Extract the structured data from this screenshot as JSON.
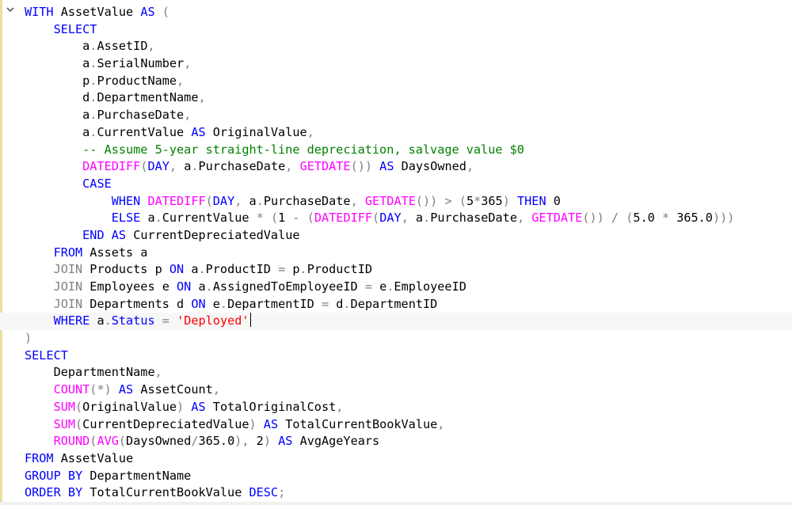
{
  "editor": {
    "fold_icon": "chevron-down-icon",
    "colors": {
      "keyword": "#0000ff",
      "function": "#ff00ff",
      "comment": "#008000",
      "string": "#ff0000",
      "operator": "#808080",
      "plain": "#000000"
    },
    "current_line_index": 18,
    "lines": [
      [
        [
          "kw",
          "WITH"
        ],
        [
          "pl",
          " AssetValue "
        ],
        [
          "kw",
          "AS"
        ],
        [
          "pl",
          " "
        ],
        [
          "op",
          "("
        ]
      ],
      [
        [
          "pl",
          "    "
        ],
        [
          "kw",
          "SELECT"
        ]
      ],
      [
        [
          "pl",
          "        a"
        ],
        [
          "op",
          "."
        ],
        [
          "pl",
          "AssetID"
        ],
        [
          "op",
          ","
        ]
      ],
      [
        [
          "pl",
          "        a"
        ],
        [
          "op",
          "."
        ],
        [
          "pl",
          "SerialNumber"
        ],
        [
          "op",
          ","
        ]
      ],
      [
        [
          "pl",
          "        p"
        ],
        [
          "op",
          "."
        ],
        [
          "pl",
          "ProductName"
        ],
        [
          "op",
          ","
        ]
      ],
      [
        [
          "pl",
          "        d"
        ],
        [
          "op",
          "."
        ],
        [
          "pl",
          "DepartmentName"
        ],
        [
          "op",
          ","
        ]
      ],
      [
        [
          "pl",
          "        a"
        ],
        [
          "op",
          "."
        ],
        [
          "pl",
          "PurchaseDate"
        ],
        [
          "op",
          ","
        ]
      ],
      [
        [
          "pl",
          "        a"
        ],
        [
          "op",
          "."
        ],
        [
          "pl",
          "CurrentValue "
        ],
        [
          "kw",
          "AS"
        ],
        [
          "pl",
          " OriginalValue"
        ],
        [
          "op",
          ","
        ]
      ],
      [
        [
          "pl",
          "        "
        ],
        [
          "cm",
          "-- Assume 5-year straight-line depreciation, salvage value $0"
        ]
      ],
      [
        [
          "pl",
          "        "
        ],
        [
          "fn",
          "DATEDIFF"
        ],
        [
          "op",
          "("
        ],
        [
          "kw",
          "DAY"
        ],
        [
          "op",
          ","
        ],
        [
          "pl",
          " a"
        ],
        [
          "op",
          "."
        ],
        [
          "pl",
          "PurchaseDate"
        ],
        [
          "op",
          ","
        ],
        [
          "pl",
          " "
        ],
        [
          "fn",
          "GETDATE"
        ],
        [
          "op",
          "())"
        ],
        [
          "pl",
          " "
        ],
        [
          "kw",
          "AS"
        ],
        [
          "pl",
          " DaysOwned"
        ],
        [
          "op",
          ","
        ]
      ],
      [
        [
          "pl",
          "        "
        ],
        [
          "kw",
          "CASE"
        ]
      ],
      [
        [
          "pl",
          "            "
        ],
        [
          "kw",
          "WHEN"
        ],
        [
          "pl",
          " "
        ],
        [
          "fn",
          "DATEDIFF"
        ],
        [
          "op",
          "("
        ],
        [
          "kw",
          "DAY"
        ],
        [
          "op",
          ","
        ],
        [
          "pl",
          " a"
        ],
        [
          "op",
          "."
        ],
        [
          "pl",
          "PurchaseDate"
        ],
        [
          "op",
          ","
        ],
        [
          "pl",
          " "
        ],
        [
          "fn",
          "GETDATE"
        ],
        [
          "op",
          "())"
        ],
        [
          "pl",
          " "
        ],
        [
          "op",
          ">"
        ],
        [
          "pl",
          " "
        ],
        [
          "op",
          "("
        ],
        [
          "pl",
          "5"
        ],
        [
          "op",
          "*"
        ],
        [
          "pl",
          "365"
        ],
        [
          "op",
          ")"
        ],
        [
          "pl",
          " "
        ],
        [
          "kw",
          "THEN"
        ],
        [
          "pl",
          " 0"
        ]
      ],
      [
        [
          "pl",
          "            "
        ],
        [
          "kw",
          "ELSE"
        ],
        [
          "pl",
          " a"
        ],
        [
          "op",
          "."
        ],
        [
          "pl",
          "CurrentValue "
        ],
        [
          "op",
          "*"
        ],
        [
          "pl",
          " "
        ],
        [
          "op",
          "("
        ],
        [
          "pl",
          "1 "
        ],
        [
          "op",
          "-"
        ],
        [
          "pl",
          " "
        ],
        [
          "op",
          "("
        ],
        [
          "fn",
          "DATEDIFF"
        ],
        [
          "op",
          "("
        ],
        [
          "kw",
          "DAY"
        ],
        [
          "op",
          ","
        ],
        [
          "pl",
          " a"
        ],
        [
          "op",
          "."
        ],
        [
          "pl",
          "PurchaseDate"
        ],
        [
          "op",
          ","
        ],
        [
          "pl",
          " "
        ],
        [
          "fn",
          "GETDATE"
        ],
        [
          "op",
          "())"
        ],
        [
          "pl",
          " "
        ],
        [
          "op",
          "/"
        ],
        [
          "pl",
          " "
        ],
        [
          "op",
          "("
        ],
        [
          "pl",
          "5.0 "
        ],
        [
          "op",
          "*"
        ],
        [
          "pl",
          " 365.0"
        ],
        [
          "op",
          ")))"
        ]
      ],
      [
        [
          "pl",
          "        "
        ],
        [
          "kw",
          "END"
        ],
        [
          "pl",
          " "
        ],
        [
          "kw",
          "AS"
        ],
        [
          "pl",
          " CurrentDepreciatedValue"
        ]
      ],
      [
        [
          "pl",
          "    "
        ],
        [
          "kw",
          "FROM"
        ],
        [
          "pl",
          " Assets a"
        ]
      ],
      [
        [
          "pl",
          "    "
        ],
        [
          "op",
          "JOIN"
        ],
        [
          "pl",
          " Products p "
        ],
        [
          "kw",
          "ON"
        ],
        [
          "pl",
          " a"
        ],
        [
          "op",
          "."
        ],
        [
          "pl",
          "ProductID "
        ],
        [
          "op",
          "="
        ],
        [
          "pl",
          " p"
        ],
        [
          "op",
          "."
        ],
        [
          "pl",
          "ProductID"
        ]
      ],
      [
        [
          "pl",
          "    "
        ],
        [
          "op",
          "JOIN"
        ],
        [
          "pl",
          " Employees e "
        ],
        [
          "kw",
          "ON"
        ],
        [
          "pl",
          " a"
        ],
        [
          "op",
          "."
        ],
        [
          "pl",
          "AssignedToEmployeeID "
        ],
        [
          "op",
          "="
        ],
        [
          "pl",
          " e"
        ],
        [
          "op",
          "."
        ],
        [
          "pl",
          "EmployeeID"
        ]
      ],
      [
        [
          "pl",
          "    "
        ],
        [
          "op",
          "JOIN"
        ],
        [
          "pl",
          " Departments d "
        ],
        [
          "kw",
          "ON"
        ],
        [
          "pl",
          " e"
        ],
        [
          "op",
          "."
        ],
        [
          "pl",
          "DepartmentID "
        ],
        [
          "op",
          "="
        ],
        [
          "pl",
          " d"
        ],
        [
          "op",
          "."
        ],
        [
          "pl",
          "DepartmentID"
        ]
      ],
      [
        [
          "pl",
          "    "
        ],
        [
          "kw",
          "WHERE"
        ],
        [
          "pl",
          " a"
        ],
        [
          "op",
          "."
        ],
        [
          "kw",
          "Status"
        ],
        [
          "pl",
          " "
        ],
        [
          "op",
          "="
        ],
        [
          "pl",
          " "
        ],
        [
          "st",
          "'Deployed'"
        ]
      ],
      [
        [
          "op",
          ")"
        ]
      ],
      [
        [
          "kw",
          "SELECT"
        ]
      ],
      [
        [
          "pl",
          "    DepartmentName"
        ],
        [
          "op",
          ","
        ]
      ],
      [
        [
          "pl",
          "    "
        ],
        [
          "fn",
          "COUNT"
        ],
        [
          "op",
          "(*)"
        ],
        [
          "pl",
          " "
        ],
        [
          "kw",
          "AS"
        ],
        [
          "pl",
          " AssetCount"
        ],
        [
          "op",
          ","
        ]
      ],
      [
        [
          "pl",
          "    "
        ],
        [
          "fn",
          "SUM"
        ],
        [
          "op",
          "("
        ],
        [
          "pl",
          "OriginalValue"
        ],
        [
          "op",
          ")"
        ],
        [
          "pl",
          " "
        ],
        [
          "kw",
          "AS"
        ],
        [
          "pl",
          " TotalOriginalCost"
        ],
        [
          "op",
          ","
        ]
      ],
      [
        [
          "pl",
          "    "
        ],
        [
          "fn",
          "SUM"
        ],
        [
          "op",
          "("
        ],
        [
          "pl",
          "CurrentDepreciatedValue"
        ],
        [
          "op",
          ")"
        ],
        [
          "pl",
          " "
        ],
        [
          "kw",
          "AS"
        ],
        [
          "pl",
          " TotalCurrentBookValue"
        ],
        [
          "op",
          ","
        ]
      ],
      [
        [
          "pl",
          "    "
        ],
        [
          "fn",
          "ROUND"
        ],
        [
          "op",
          "("
        ],
        [
          "fn",
          "AVG"
        ],
        [
          "op",
          "("
        ],
        [
          "pl",
          "DaysOwned"
        ],
        [
          "op",
          "/"
        ],
        [
          "pl",
          "365.0"
        ],
        [
          "op",
          "),"
        ],
        [
          "pl",
          " 2"
        ],
        [
          "op",
          ")"
        ],
        [
          "pl",
          " "
        ],
        [
          "kw",
          "AS"
        ],
        [
          "pl",
          " AvgAgeYears"
        ]
      ],
      [
        [
          "kw",
          "FROM"
        ],
        [
          "pl",
          " AssetValue"
        ]
      ],
      [
        [
          "kw",
          "GROUP"
        ],
        [
          "pl",
          " "
        ],
        [
          "kw",
          "BY"
        ],
        [
          "pl",
          " DepartmentName"
        ]
      ],
      [
        [
          "kw",
          "ORDER"
        ],
        [
          "pl",
          " "
        ],
        [
          "kw",
          "BY"
        ],
        [
          "pl",
          " TotalCurrentBookValue "
        ],
        [
          "kw",
          "DESC"
        ],
        [
          "op",
          ";"
        ]
      ]
    ]
  }
}
